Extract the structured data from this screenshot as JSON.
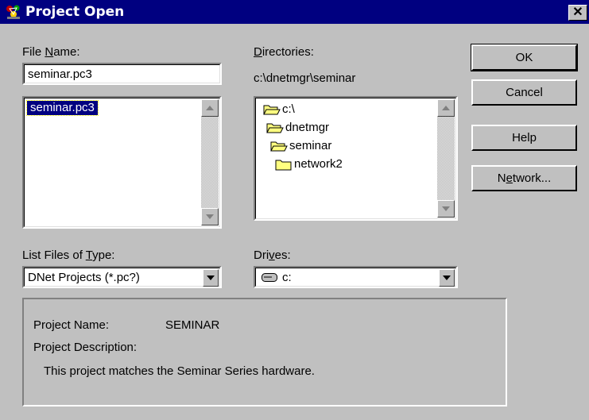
{
  "window": {
    "title": "Project Open",
    "close_glyph": "✕",
    "app_icon": "network-app-icon"
  },
  "file_name": {
    "label_pre": "File ",
    "label_mnemonic": "N",
    "label_post": "ame:",
    "value": "seminar.pc3"
  },
  "file_list": {
    "items": [
      "seminar.pc3"
    ],
    "selected_index": 0
  },
  "directories": {
    "label_pre": "",
    "label_mnemonic": "D",
    "label_post": "irectories:",
    "current_path": "c:\\dnetmgr\\seminar",
    "items": [
      {
        "label": "c:\\",
        "icon": "open-folder-icon"
      },
      {
        "label": "dnetmgr",
        "icon": "open-folder-icon"
      },
      {
        "label": "seminar",
        "icon": "open-folder-icon"
      },
      {
        "label": "network2",
        "icon": "closed-folder-icon"
      }
    ]
  },
  "file_type": {
    "label_pre": "List Files of ",
    "label_mnemonic": "T",
    "label_post": "ype:",
    "selected": "DNet Projects (*.pc?)"
  },
  "drives": {
    "label_pre": "Dri",
    "label_mnemonic": "v",
    "label_post": "es:",
    "selected": "c:",
    "icon": "drive-icon"
  },
  "buttons": {
    "ok": "OK",
    "cancel": "Cancel",
    "help": "Help",
    "network_pre": "N",
    "network_mnemonic": "e",
    "network_post": "twork..."
  },
  "project_info": {
    "name_label": "Project Name:",
    "name_value": "SEMINAR",
    "description_label": "Project Description:",
    "description_value": "This project matches the Seminar Series hardware."
  },
  "colors": {
    "titlebar": "#000080",
    "face": "#c0c0c0",
    "selection": "#000080",
    "folder": "#ffff80"
  }
}
